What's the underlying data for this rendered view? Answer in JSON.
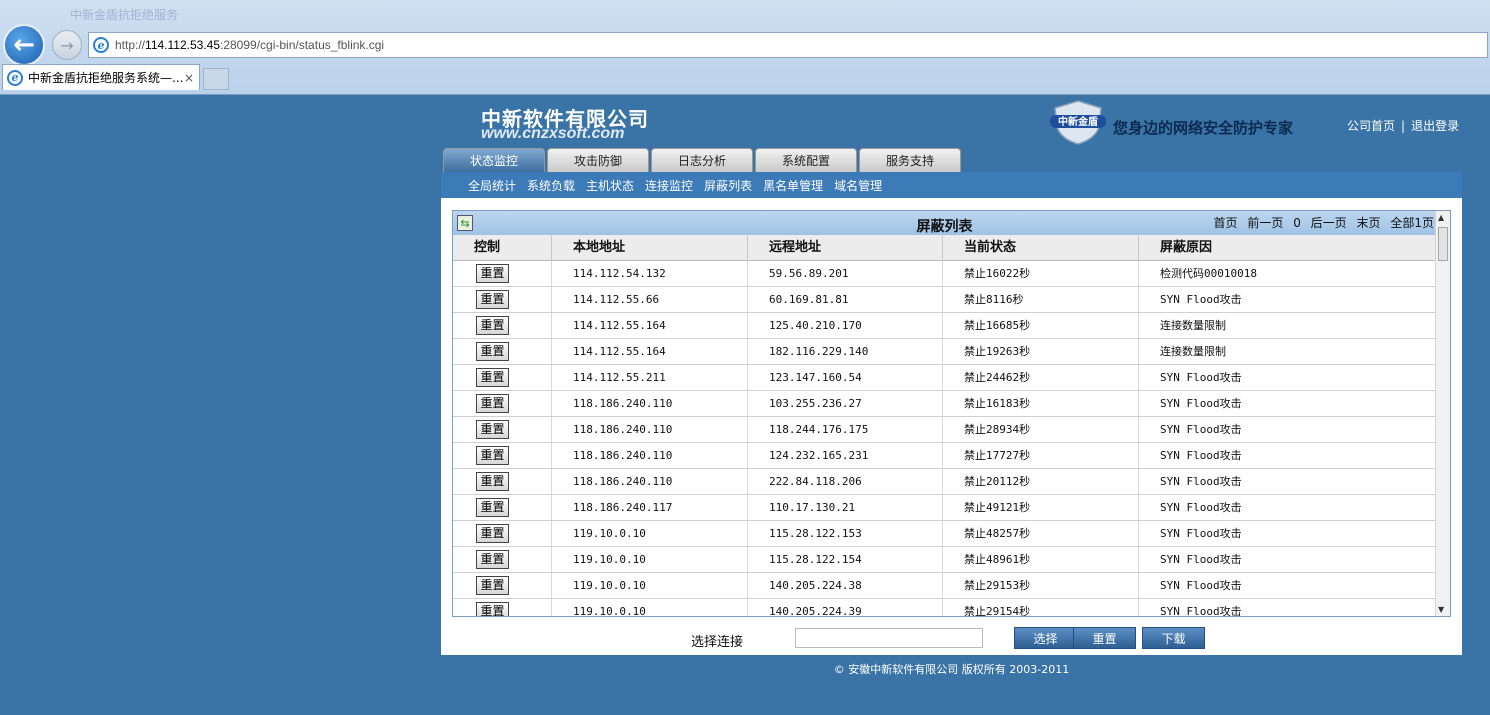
{
  "browser": {
    "window_title": "中新金盾抗拒绝服务",
    "back_label": "←",
    "forward_label": "→",
    "url_prefix": "http://",
    "url_host": "114.112.53.45",
    "url_rest": ":28099/cgi-bin/status_fblink.cgi",
    "tab_title": "中新金盾抗拒绝服务系统—...",
    "tab_close": "×"
  },
  "header": {
    "company_cn": "中新软件有限公司",
    "company_en": "www.cnzxsoft.com",
    "shield_text": "中新金盾",
    "slogan": "您身边的网络安全防护专家",
    "link_home": "公司首页",
    "link_sep": "|",
    "link_logout": "退出登录"
  },
  "nav": {
    "tabs": [
      "状态监控",
      "攻击防御",
      "日志分析",
      "系统配置",
      "服务支持"
    ],
    "active_tab": 0,
    "subnav": [
      "全局统计",
      "系统负载",
      "主机状态",
      "连接监控",
      "屏蔽列表",
      "黑名单管理",
      "域名管理"
    ]
  },
  "grid": {
    "title": "屏蔽列表",
    "pager": {
      "first": "首页",
      "prev": "前一页",
      "page": "0",
      "next": "后一页",
      "last": "末页",
      "total": "全部1页"
    },
    "columns": [
      "控制",
      "本地地址",
      "远程地址",
      "当前状态",
      "屏蔽原因"
    ],
    "button_label": "重置",
    "rows": [
      [
        "114.112.54.132",
        "59.56.89.201",
        "禁止16022秒",
        "检测代码00010018"
      ],
      [
        "114.112.55.66",
        "60.169.81.81",
        "禁止8116秒",
        "SYN Flood攻击"
      ],
      [
        "114.112.55.164",
        "125.40.210.170",
        "禁止16685秒",
        "连接数量限制"
      ],
      [
        "114.112.55.164",
        "182.116.229.140",
        "禁止19263秒",
        "连接数量限制"
      ],
      [
        "114.112.55.211",
        "123.147.160.54",
        "禁止24462秒",
        "SYN Flood攻击"
      ],
      [
        "118.186.240.110",
        "103.255.236.27",
        "禁止16183秒",
        "SYN Flood攻击"
      ],
      [
        "118.186.240.110",
        "118.244.176.175",
        "禁止28934秒",
        "SYN Flood攻击"
      ],
      [
        "118.186.240.110",
        "124.232.165.231",
        "禁止17727秒",
        "SYN Flood攻击"
      ],
      [
        "118.186.240.110",
        "222.84.118.206",
        "禁止20112秒",
        "SYN Flood攻击"
      ],
      [
        "118.186.240.117",
        "110.17.130.21",
        "禁止49121秒",
        "SYN Flood攻击"
      ],
      [
        "119.10.0.10",
        "115.28.122.153",
        "禁止48257秒",
        "SYN Flood攻击"
      ],
      [
        "119.10.0.10",
        "115.28.122.154",
        "禁止48961秒",
        "SYN Flood攻击"
      ],
      [
        "119.10.0.10",
        "140.205.224.38",
        "禁止29153秒",
        "SYN Flood攻击"
      ],
      [
        "119.10.0.10",
        "140.205.224.39",
        "禁止29154秒",
        "SYN Flood攻击"
      ]
    ]
  },
  "actions": {
    "select_label": "选择连接",
    "select_value": "",
    "btn_select": "选择",
    "btn_reset": "重置",
    "btn_download": "下载"
  },
  "footer": "© 安徽中新软件有限公司 版权所有 2003-2011",
  "colors": {
    "page_bg": "#3a74a6",
    "subnav_bg": "#3d7ab8",
    "button_blue": "#2e5f93"
  }
}
